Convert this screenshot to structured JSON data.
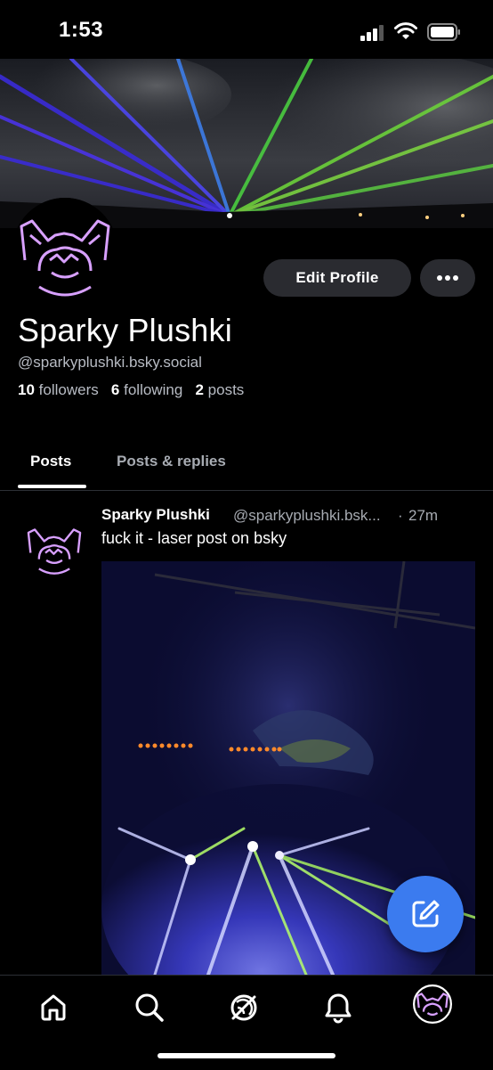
{
  "status_bar": {
    "time": "1:53"
  },
  "profile": {
    "display_name": "Sparky Plushki",
    "handle": "@sparkyplushki.bsky.social",
    "followers_count": "10",
    "followers_label": "followers",
    "following_count": "6",
    "following_label": "following",
    "posts_count": "2",
    "posts_label": "posts",
    "edit_button_label": "Edit Profile"
  },
  "tabs": [
    {
      "label": "Posts",
      "active": true
    },
    {
      "label": "Posts & replies",
      "active": false
    }
  ],
  "post": {
    "author": "Sparky Plushki",
    "handle": "@sparkyplushki.bsk...",
    "separator": "·",
    "time": "27m",
    "text": "fuck it - laser post on bsky"
  },
  "nav": [
    "home-icon",
    "search-icon",
    "feeds-icon",
    "notifications-icon",
    "profile-avatar"
  ],
  "colors": {
    "accent": "#3b7bef",
    "button_bg": "#2a2b30",
    "secondary_text": "#a7abb2"
  }
}
